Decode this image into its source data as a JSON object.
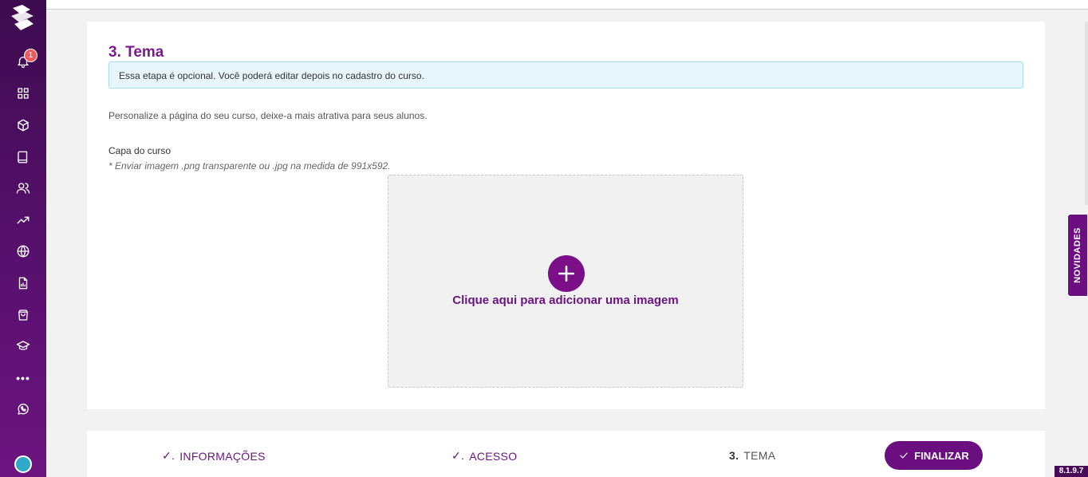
{
  "sidebar": {
    "notification_count": "1",
    "items": [
      {
        "icon": "bell-icon"
      },
      {
        "icon": "grid-icon"
      },
      {
        "icon": "box-icon"
      },
      {
        "icon": "book-icon"
      },
      {
        "icon": "users-icon"
      },
      {
        "icon": "trending-up-icon"
      },
      {
        "icon": "globe-icon"
      },
      {
        "icon": "report-icon"
      },
      {
        "icon": "shopping-bag-icon"
      },
      {
        "icon": "graduation-cap-icon"
      },
      {
        "icon": "more-icon"
      },
      {
        "icon": "whatsapp-icon"
      }
    ],
    "more_label": "•••"
  },
  "section": {
    "title": "3. Tema",
    "info": "Essa etapa é opcional. Você poderá editar depois no cadastro do curso.",
    "description": "Personalize a página do seu curso, deixe-a mais atrativa para seus alunos.",
    "cover_label": "Capa do curso",
    "cover_hint": "* Enviar imagem .png transparente ou .jpg na medida de 991x592.",
    "dropzone_text": "Clique aqui para adicionar uma imagem"
  },
  "stepper": {
    "steps": [
      {
        "label": "INFORMAÇÕES",
        "done_mark": "✓."
      },
      {
        "label": "ACESSO",
        "done_mark": "✓."
      },
      {
        "number": "3.",
        "label": "TEMA"
      }
    ],
    "finalize_label": "FINALIZAR"
  },
  "novidades_label": "NOVIDADES",
  "version": "8.1.9.7",
  "colors": {
    "brand": "#6b0f80",
    "title": "#7a1a8c",
    "info_bg": "#e6f6fc",
    "badge": "#f05a5a"
  }
}
